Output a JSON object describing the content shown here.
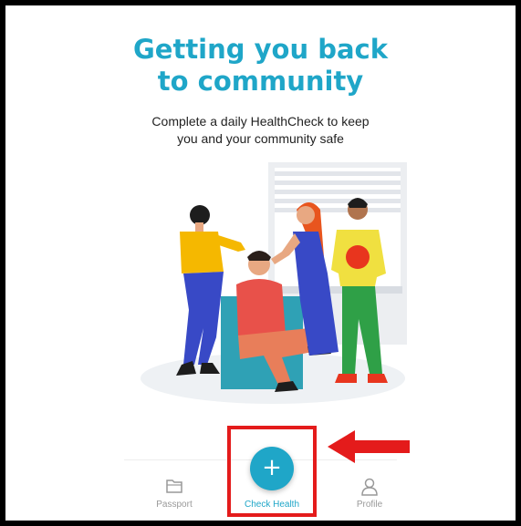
{
  "hero": {
    "title_line1": "Getting you back",
    "title_line2": "to community",
    "subtitle_line1": "Complete a daily HealthCheck to keep",
    "subtitle_line2": "you and your community safe"
  },
  "tabbar": {
    "passport_label": "Passport",
    "check_label": "Check Health",
    "profile_label": "Profile",
    "fab_label": "+"
  },
  "colors": {
    "accent": "#1fa6c8",
    "highlight": "#e41b1b",
    "inactive": "#999999"
  }
}
